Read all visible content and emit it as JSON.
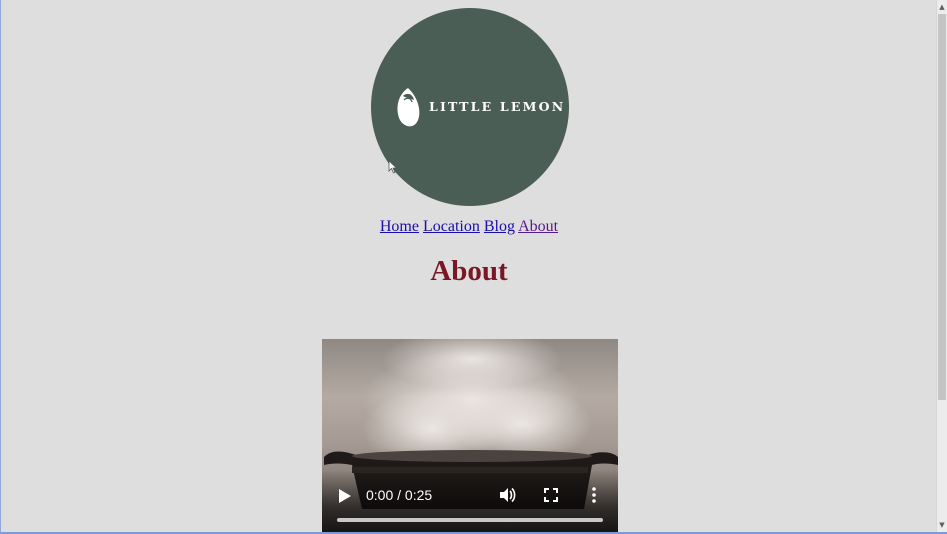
{
  "logo": {
    "text": "LITTLE LEMON",
    "color": "#4a5e56"
  },
  "nav": {
    "items": [
      "Home",
      "Location",
      "Blog",
      "About"
    ],
    "visited": "About"
  },
  "heading": "About",
  "heading_color": "#7a1725",
  "video": {
    "time": "0:00 / 0:25",
    "progress": 0,
    "icons": [
      "play-icon",
      "volume-icon",
      "fullscreen-icon",
      "more-options-icon"
    ]
  }
}
